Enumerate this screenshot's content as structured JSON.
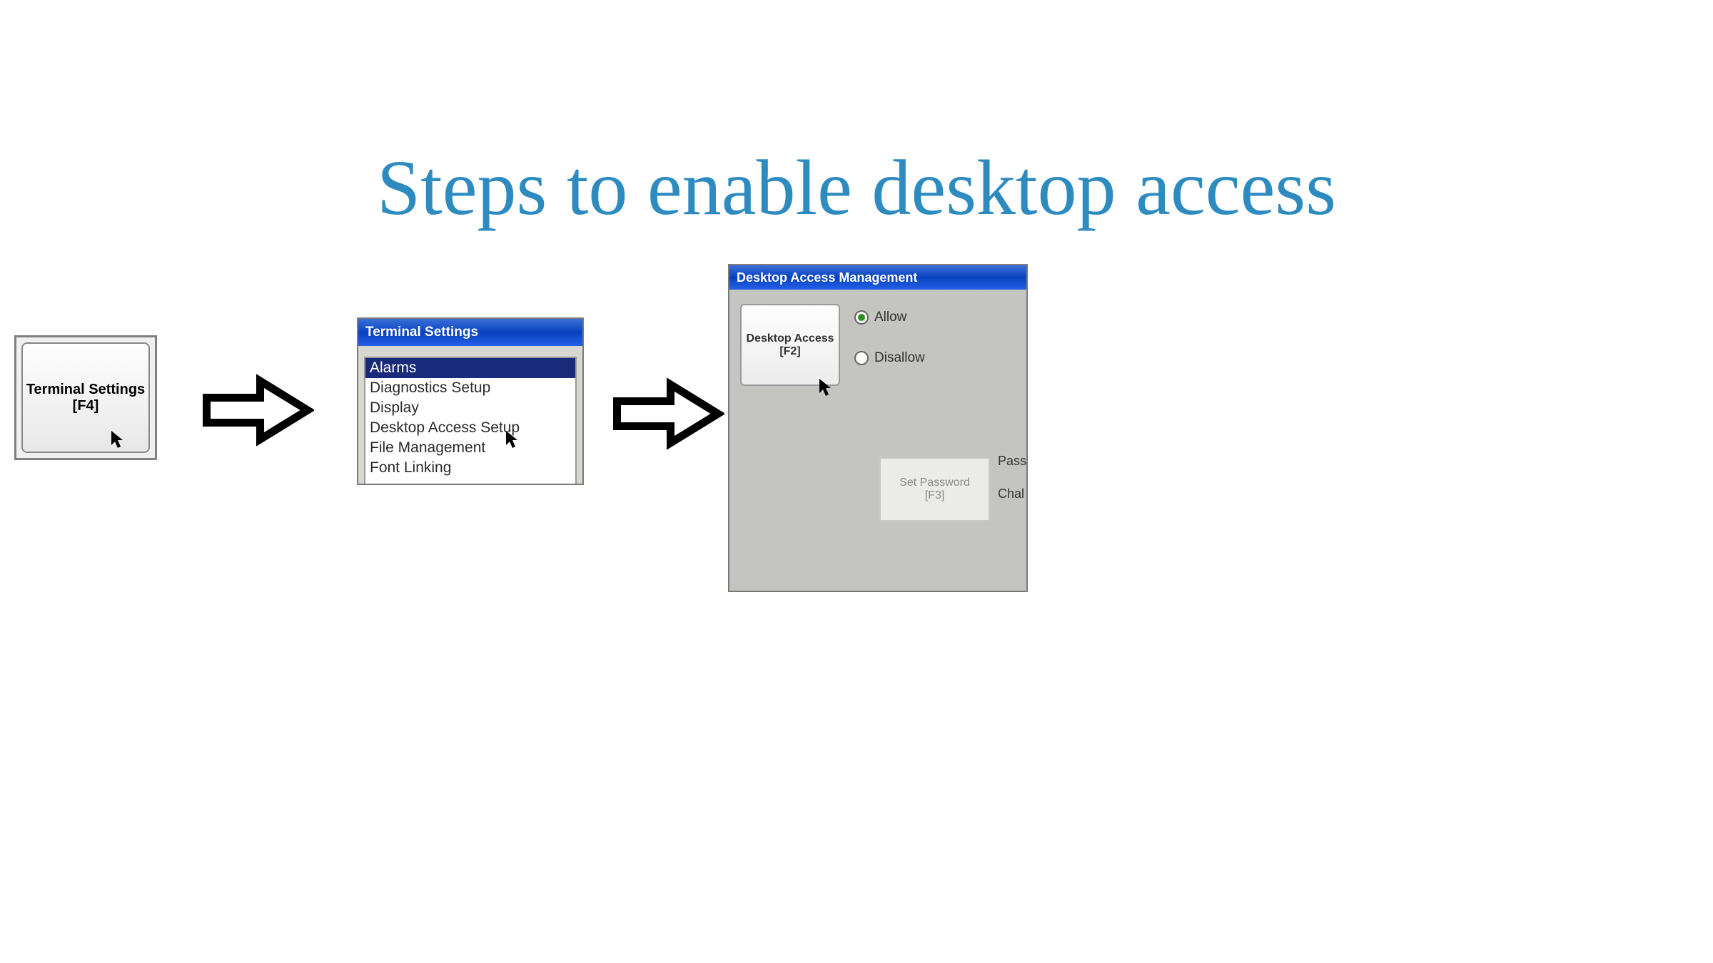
{
  "title": "Steps to enable desktop access",
  "step1": {
    "line1": "Terminal Settings",
    "line2": "[F4]"
  },
  "step2": {
    "title": "Terminal Settings",
    "items": [
      "Alarms",
      "Diagnostics Setup",
      "Display",
      "Desktop Access Setup",
      "File Management",
      "Font Linking"
    ],
    "selected_idx": 0
  },
  "step3": {
    "title": "Desktop Access Management",
    "button_line1": "Desktop Access",
    "button_line2": "[F2]",
    "radio_allow": "Allow",
    "radio_disallow": "Disallow",
    "radio_selected": "allow",
    "setpass_line1": "Set Password",
    "setpass_line2": "[F3]",
    "side_label1": "Pass",
    "side_label2": "Chal"
  }
}
